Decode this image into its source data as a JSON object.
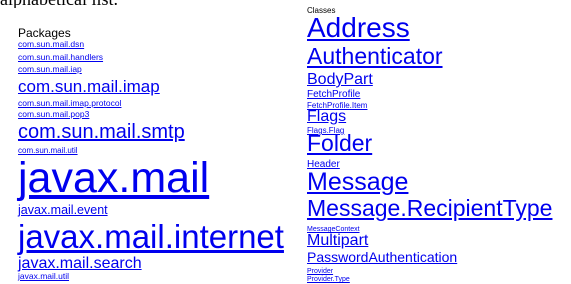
{
  "header_text": "alphabetical list.",
  "packages": {
    "heading": "Packages",
    "items": [
      {
        "label": "com.sun.mail.dsn"
      },
      {
        "label": "com.sun.mail.handlers"
      },
      {
        "label": "com.sun.mail.iap"
      },
      {
        "label": "com.sun.mail.imap"
      },
      {
        "label": "com.sun.mail.imap.protocol"
      },
      {
        "label": "com.sun.mail.pop3"
      },
      {
        "label": "com.sun.mail.smtp"
      },
      {
        "label": "com.sun.mail.util"
      },
      {
        "label": "javax.mail"
      },
      {
        "label": "javax.mail.event"
      },
      {
        "label": "javax.mail.internet"
      },
      {
        "label": "javax.mail.search"
      },
      {
        "label": "javax.mail.util"
      }
    ]
  },
  "classes": {
    "heading": "Classes",
    "items": [
      {
        "label": "Address"
      },
      {
        "label": "Authenticator"
      },
      {
        "label": "BodyPart"
      },
      {
        "label": "FetchProfile"
      },
      {
        "label": "FetchProfile.Item"
      },
      {
        "label": "Flags"
      },
      {
        "label": "Flags.Flag"
      },
      {
        "label": "Folder"
      },
      {
        "label": "Header"
      },
      {
        "label": "Message"
      },
      {
        "label": "Message.RecipientType"
      },
      {
        "label": "MessageContext"
      },
      {
        "label": "Multipart"
      },
      {
        "label": "PasswordAuthentication"
      },
      {
        "label": "Provider"
      },
      {
        "label": "Provider.Type"
      }
    ]
  },
  "colors": {
    "link": "#0000ee",
    "text": "#000000",
    "background": "#ffffff"
  }
}
